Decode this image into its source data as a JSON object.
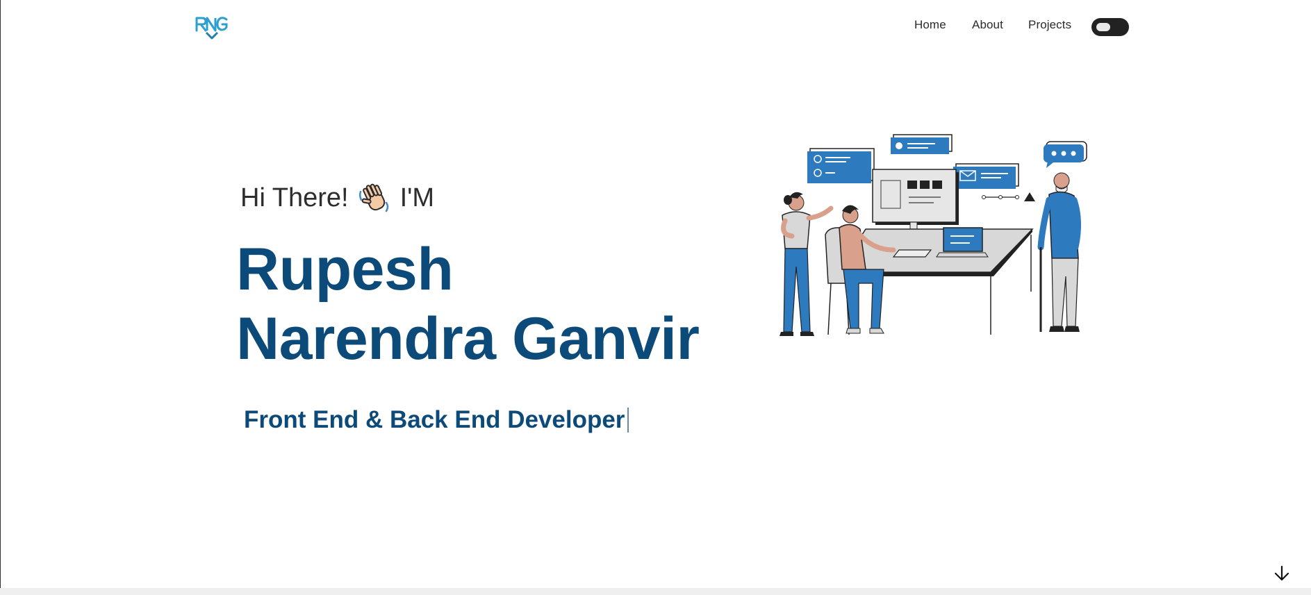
{
  "nav": {
    "logo_text": "RNG",
    "links": [
      "Home",
      "About",
      "Projects"
    ],
    "theme_toggle_icon": "toggle-switch-icon"
  },
  "hero": {
    "greeting_before": "Hi There!",
    "greeting_emoji": "waving-hand-icon",
    "greeting_after": "I'M",
    "name": "Rupesh Narendra Ganvir",
    "role": "Front End & Back End Developer"
  },
  "illustration": {
    "icon": "developers-team-illustration"
  },
  "scroll": {
    "icon": "arrow-down-icon"
  },
  "colors": {
    "brand_blue": "#0c4a7a",
    "accent_blue": "#2e7abf",
    "logo_cyan": "#2a9fd0"
  }
}
